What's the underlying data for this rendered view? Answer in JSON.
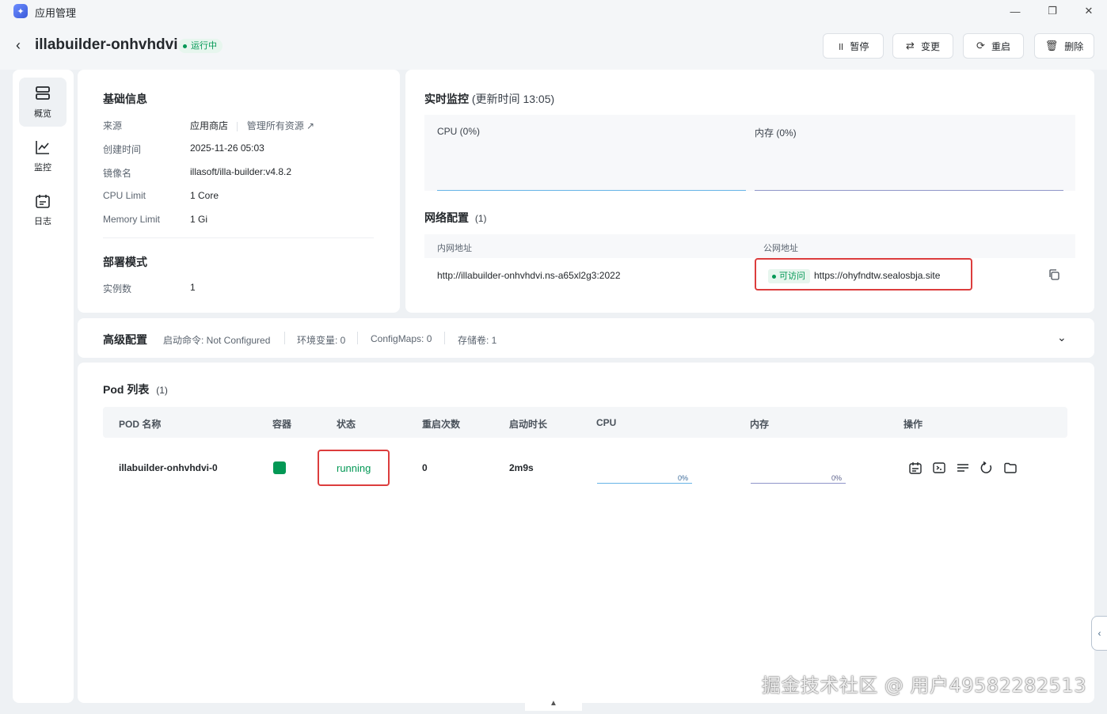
{
  "window": {
    "title": "应用管理"
  },
  "header": {
    "app_name": "illabuilder-onhvhdvi",
    "status": "运行中",
    "buttons": {
      "pause": "暂停",
      "change": "变更",
      "restart": "重启",
      "delete": "删除"
    }
  },
  "sidebar": {
    "items": [
      {
        "label": "概览",
        "icon": "overview-icon"
      },
      {
        "label": "监控",
        "icon": "chart-icon"
      },
      {
        "label": "日志",
        "icon": "log-icon"
      }
    ]
  },
  "basic_info": {
    "title": "基础信息",
    "source_key": "来源",
    "source_val": "应用商店",
    "source_link": "管理所有资源 ↗",
    "created_key": "创建时间",
    "created_val": "2025-11-26 05:03",
    "image_key": "镜像名",
    "image_val": "illasoft/illa-builder:v4.8.2",
    "cpu_key": "CPU Limit",
    "cpu_val": "1 Core",
    "mem_key": "Memory Limit",
    "mem_val": "1 Gi",
    "deploy_title": "部署模式",
    "instances_key": "实例数",
    "instances_val": "1"
  },
  "monitor": {
    "title": "实时监控",
    "updated": "(更新时间 13:05)",
    "cpu_label": "CPU (0%)",
    "mem_label": "内存 (0%)"
  },
  "network": {
    "title": "网络配置",
    "count": "(1)",
    "col_private": "内网地址",
    "col_public": "公网地址",
    "private_addr": "http://illabuilder-onhvhdvi.ns-a65xl2g3:2022",
    "public_status": "可访问",
    "public_addr": "https://ohyfndtw.sealosbja.site"
  },
  "advanced": {
    "title": "高级配置",
    "startup": "启动命令: Not Configured",
    "env": "环境变量: 0",
    "configmaps": "ConfigMaps: 0",
    "storage": "存储卷: 1"
  },
  "pods": {
    "title": "Pod 列表",
    "count": "(1)",
    "columns": [
      "POD 名称",
      "容器",
      "状态",
      "重启次数",
      "启动时长",
      "CPU",
      "内存",
      "操作"
    ],
    "rows": [
      {
        "name": "illabuilder-onhvhdvi-0",
        "status": "running",
        "restarts": "0",
        "uptime": "2m9s",
        "cpu": "0%",
        "mem": "0%"
      }
    ]
  },
  "colors": {
    "accent": "#039855",
    "highlight": "#dc3d3d",
    "cpu_line": "#66b3e6",
    "mem_line": "#8f95c9"
  },
  "watermark": "掘金技术社区 @ 用户49582282513"
}
